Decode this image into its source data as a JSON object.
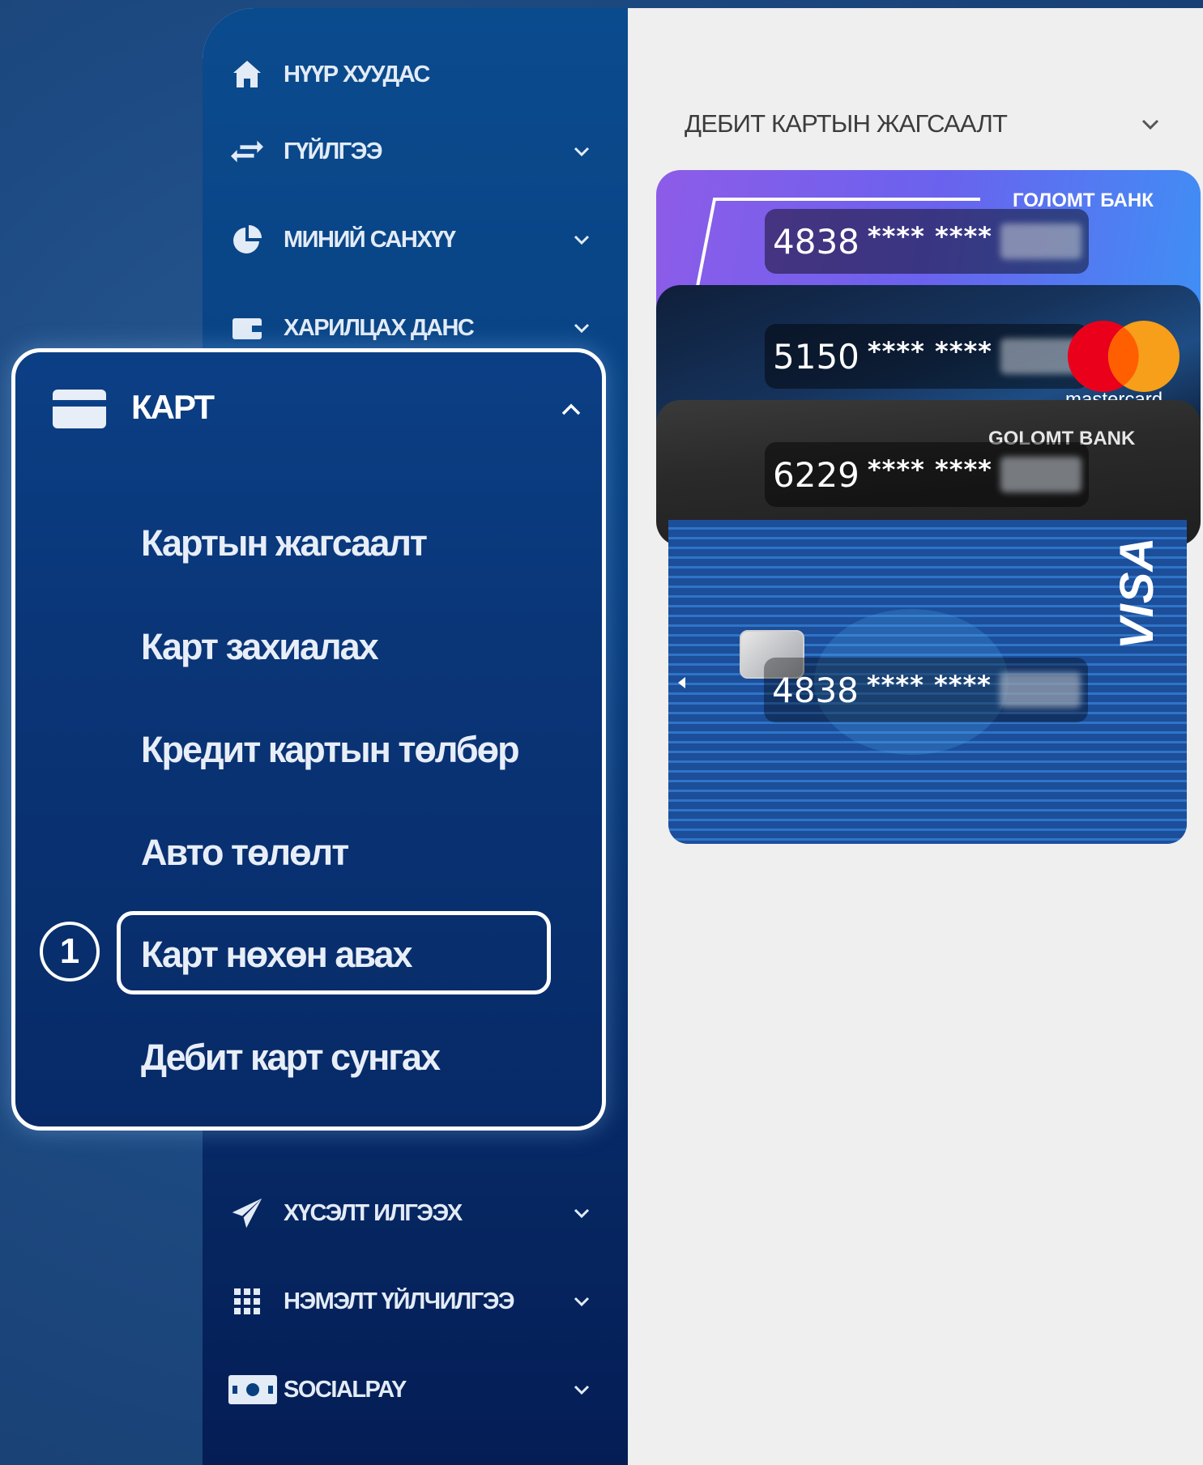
{
  "sidebar": {
    "items": [
      {
        "label": "НҮҮР ХУУДАС",
        "icon": "home-icon",
        "has_chevron": false
      },
      {
        "label": "ГҮЙЛГЭЭ",
        "icon": "transfer-icon",
        "has_chevron": true
      },
      {
        "label": "МИНИЙ САНХҮҮ",
        "icon": "pie-chart-icon",
        "has_chevron": true
      },
      {
        "label": "ХАРИЛЦАХ ДАНС",
        "icon": "wallet-icon",
        "has_chevron": true
      },
      {
        "label": "ХҮСЭЛТ ИЛГЭЭХ",
        "icon": "send-icon",
        "has_chevron": true
      },
      {
        "label": "НЭМЭЛТ ҮЙЛЧИЛГЭЭ",
        "icon": "grid-icon",
        "has_chevron": true
      },
      {
        "label": "SOCIALPAY",
        "icon": "cash-icon",
        "has_chevron": true
      }
    ]
  },
  "card_menu": {
    "label": "КАРТ",
    "icon": "card-icon",
    "submenu": [
      "Картын жагсаалт",
      "Карт захиалах",
      "Кредит картын төлбөр",
      "Авто төлөлт",
      "Карт нөхөн авах",
      "Дебит карт сунгах"
    ],
    "highlighted_index": 4,
    "step_number": "1"
  },
  "content": {
    "title": "ДЕБИТ КАРТЫН ЖАГСААЛТ",
    "cards": [
      {
        "prefix": "4838",
        "mask": "**** ****",
        "brand": "ГОЛОМТ БАНК"
      },
      {
        "prefix": "5150",
        "mask": "**** ****",
        "brand": "mastercard"
      },
      {
        "prefix": "6229",
        "mask": "**** ****",
        "brand": "GOLOMT BANK"
      },
      {
        "prefix": "4838",
        "mask": "**** ****",
        "brand": "VISA"
      }
    ]
  },
  "colors": {
    "background": "#1d4a82",
    "sidebar": "#083f80",
    "highlight_border": "#ffffff",
    "content_bg": "#efefef"
  }
}
